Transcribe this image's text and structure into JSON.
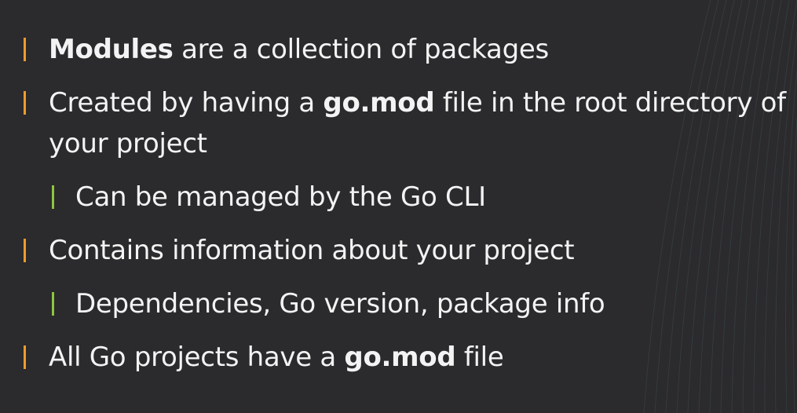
{
  "slide": {
    "colors": {
      "background": "#2b2a2c",
      "text": "#f3f3f3",
      "bullet_level1": "#f29b2c",
      "bullet_level2": "#8cc63e"
    },
    "bullets": [
      {
        "level": 1,
        "segments": [
          {
            "text": "Modules",
            "bold": true
          },
          {
            "text": " are a collection of packages",
            "bold": false
          }
        ]
      },
      {
        "level": 1,
        "segments": [
          {
            "text": "Created by having a ",
            "bold": false
          },
          {
            "text": "go.mod",
            "bold": true
          },
          {
            "text": " file in the root directory of",
            "bold": false
          }
        ]
      },
      {
        "level": 1,
        "continuation": true,
        "segments": [
          {
            "text": "your project",
            "bold": false
          }
        ]
      },
      {
        "level": 2,
        "segments": [
          {
            "text": "Can be managed by the Go CLI",
            "bold": false
          }
        ]
      },
      {
        "level": 1,
        "segments": [
          {
            "text": "Contains information about your project",
            "bold": false
          }
        ]
      },
      {
        "level": 2,
        "segments": [
          {
            "text": "Dependencies, Go version, package info",
            "bold": false
          }
        ]
      },
      {
        "level": 1,
        "segments": [
          {
            "text": "All Go projects have a ",
            "bold": false
          },
          {
            "text": "go.mod",
            "bold": true
          },
          {
            "text": " file",
            "bold": false
          }
        ]
      }
    ]
  }
}
